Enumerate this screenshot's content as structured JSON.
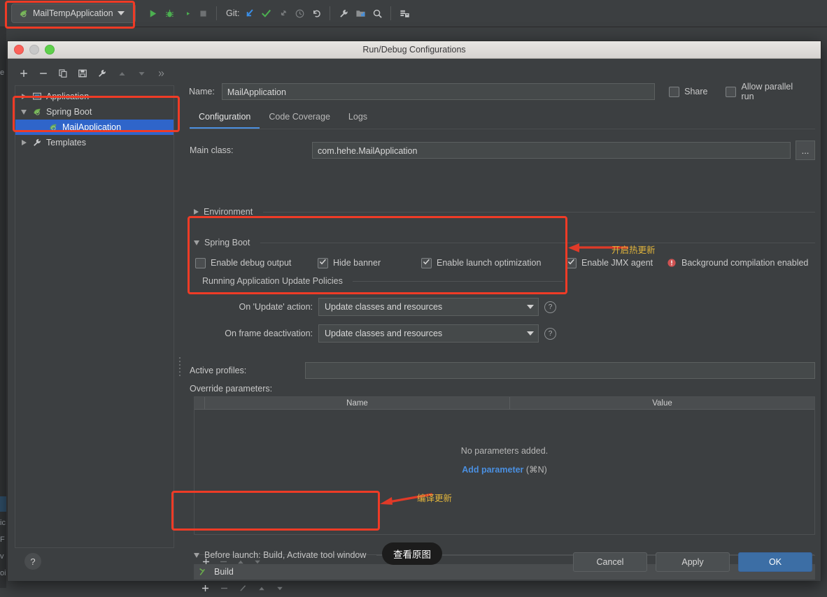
{
  "ide_toolbar": {
    "run_config": {
      "label": "MailTempApplication",
      "icon": "springboot-leaf-icon",
      "caret": "chevron-down-icon"
    },
    "buttons": [
      {
        "name": "run-button",
        "icon": "play-icon"
      },
      {
        "name": "debug-button",
        "icon": "bug-icon"
      },
      {
        "name": "run-with-coverage-button",
        "icon": "coverage-icon"
      },
      {
        "name": "stop-button",
        "icon": "stop-icon"
      }
    ],
    "git_label": "Git:",
    "git_buttons": [
      {
        "name": "git-update-button",
        "icon": "update-project-icon"
      },
      {
        "name": "git-commit-button",
        "icon": "check-icon"
      },
      {
        "name": "git-push-button",
        "icon": "push-icon"
      },
      {
        "name": "git-history-button",
        "icon": "clock-icon"
      },
      {
        "name": "git-rollback-button",
        "icon": "undo-icon"
      }
    ],
    "right_buttons": [
      {
        "name": "settings-button",
        "icon": "wrench-icon"
      },
      {
        "name": "project-structure-button",
        "icon": "project-structure-icon"
      },
      {
        "name": "search-everywhere-button",
        "icon": "search-icon"
      },
      {
        "name": "database-button",
        "icon": "database-icon"
      }
    ]
  },
  "gutter_fragments": [
    "e",
    "ic",
    "F",
    "v",
    "oi"
  ],
  "dialog": {
    "title": "Run/Debug Configurations",
    "window_buttons": [
      "close",
      "minimize",
      "zoom"
    ],
    "tree_toolbar": [
      {
        "name": "add-configuration-button",
        "icon": "plus-icon"
      },
      {
        "name": "remove-configuration-button",
        "icon": "minus-icon"
      },
      {
        "name": "copy-configuration-button",
        "icon": "copy-icon"
      },
      {
        "name": "save-configuration-button",
        "icon": "save-icon"
      },
      {
        "name": "edit-templates-button",
        "icon": "wrench-icon"
      },
      {
        "name": "move-up-button",
        "icon": "arrow-up-icon"
      },
      {
        "name": "move-down-button",
        "icon": "arrow-down-icon"
      },
      {
        "name": "more-button",
        "icon": "chevron-double-right-icon"
      }
    ],
    "tree": [
      {
        "label": "Application",
        "icon": "application-icon",
        "expanded": false,
        "level": 0,
        "selected": false
      },
      {
        "label": "Spring Boot",
        "icon": "springboot-leaf-icon",
        "expanded": true,
        "level": 0,
        "selected": false
      },
      {
        "label": "MailApplication",
        "icon": "springboot-leaf-icon",
        "expanded": null,
        "level": 1,
        "selected": true
      },
      {
        "label": "Templates",
        "icon": "wrench-icon",
        "expanded": false,
        "level": 0,
        "selected": false
      }
    ],
    "name": {
      "label": "Name:",
      "value": "MailApplication"
    },
    "share": {
      "label": "Share",
      "checked": false
    },
    "allow_parallel": {
      "label": "Allow parallel run",
      "checked": false
    },
    "tabs": [
      {
        "label": "Configuration",
        "active": true
      },
      {
        "label": "Code Coverage",
        "active": false
      },
      {
        "label": "Logs",
        "active": false
      }
    ],
    "main_class": {
      "label": "Main class:",
      "value": "com.hehe.MailApplication",
      "browse": "..."
    },
    "environment": {
      "label": "Environment",
      "expanded": false
    },
    "spring_boot": {
      "label": "Spring Boot",
      "expanded": true,
      "checkboxes": [
        {
          "label": "Enable debug output",
          "checked": false
        },
        {
          "label": "Hide banner",
          "checked": true
        },
        {
          "label": "Enable launch optimization",
          "checked": true
        },
        {
          "label": "Enable JMX agent",
          "checked": true
        }
      ],
      "warning": {
        "icon": "error-circle-icon",
        "label": "Background compilation enabled",
        "color": "#d05050"
      }
    },
    "update_policies": {
      "legend": "Running Application Update Policies",
      "rows": [
        {
          "label": "On 'Update' action:",
          "value": "Update classes and resources",
          "help": "help-icon"
        },
        {
          "label": "On frame deactivation:",
          "value": "Update classes and resources",
          "help": "help-icon"
        }
      ]
    },
    "active_profiles": {
      "label": "Active profiles:",
      "value": ""
    },
    "override_parameters": {
      "label": "Override parameters:",
      "columns": [
        "Name",
        "Value"
      ],
      "rows": [],
      "empty_text": "No parameters added.",
      "add_link": "Add parameter",
      "add_shortcut": "(⌘N)",
      "footer_buttons": [
        {
          "name": "add-parameter-button",
          "icon": "plus-icon",
          "enabled": true
        },
        {
          "name": "remove-parameter-button",
          "icon": "minus-icon",
          "enabled": false
        },
        {
          "name": "move-parameter-up-button",
          "icon": "arrow-up-icon",
          "enabled": false
        },
        {
          "name": "move-parameter-down-button",
          "icon": "arrow-down-icon",
          "enabled": false
        }
      ]
    },
    "before_launch": {
      "header": "Before launch: Build, Activate tool window",
      "items": [
        {
          "label": "Build",
          "icon": "build-hammer-icon"
        }
      ],
      "footer_buttons": [
        {
          "name": "add-task-button",
          "icon": "plus-icon",
          "enabled": true
        },
        {
          "name": "remove-task-button",
          "icon": "minus-icon",
          "enabled": false
        },
        {
          "name": "edit-task-button",
          "icon": "pencil-icon",
          "enabled": false
        },
        {
          "name": "move-task-up-button",
          "icon": "arrow-up-icon",
          "enabled": false
        },
        {
          "name": "move-task-down-button",
          "icon": "arrow-down-icon",
          "enabled": false
        }
      ]
    },
    "help_button": "?",
    "buttons": {
      "cancel": "Cancel",
      "apply": "Apply",
      "ok": "OK"
    }
  },
  "overlay": {
    "view_original_pill": "查看原图",
    "annotations": [
      {
        "text": "开启热更新",
        "color": "#e0b43c"
      },
      {
        "text": "编译更新",
        "color": "#e0b43c"
      }
    ],
    "highlight_color": "#ef3b26"
  }
}
